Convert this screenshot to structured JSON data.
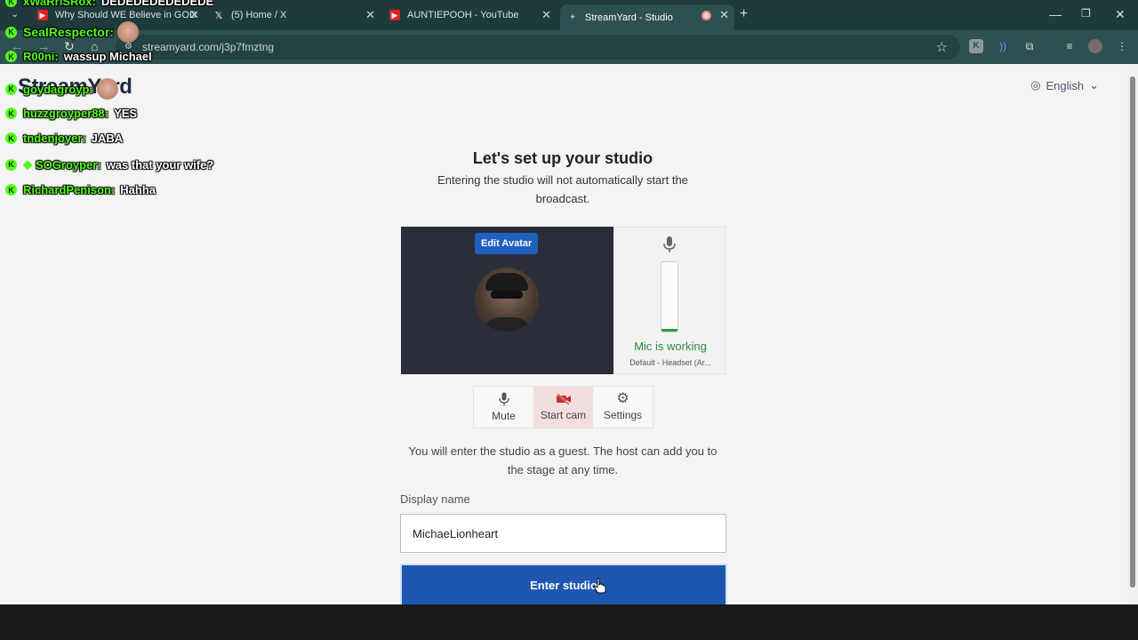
{
  "browser": {
    "tabs": [
      {
        "title": "Why Should WE Believe in GOD",
        "favicon": "youtube-icon"
      },
      {
        "title": "(5) Home / X",
        "favicon": "x-icon"
      },
      {
        "title": "AUNTIEPOOH - YouTube",
        "favicon": "youtube-icon"
      },
      {
        "title": "StreamYard - Studio",
        "favicon": "streamyard-icon",
        "active": true
      }
    ],
    "url": "streamyard.com/j3p7fmztng"
  },
  "page": {
    "logo": "StreamYard",
    "language": "English",
    "heading": "Let's set up your studio",
    "subtext": "Entering the studio will not automatically start the broadcast.",
    "edit_avatar": "Edit Avatar",
    "mic_status": "Mic is working",
    "mic_device": "Default - Headset (Ar...",
    "mic_level": 0.04,
    "controls": {
      "mute": "Mute",
      "start_cam": "Start cam",
      "settings": "Settings"
    },
    "guest_message": "You will enter the studio as a guest. The host can add you to the stage at any time.",
    "display_name_label": "Display name",
    "display_name_value": "MichaeLionheart",
    "enter_button": "Enter studio"
  },
  "chat": [
    {
      "user": "xWaRriSRox:",
      "message": "DEDEDEDEDEDEDE"
    },
    {
      "user": "SealRespector:",
      "message": ""
    },
    {
      "user": "R00ni:",
      "message": "wassup Michael"
    },
    {
      "user": "goydagroyp:",
      "message": ""
    },
    {
      "user": "huzzgroyper88:",
      "message": "YES"
    },
    {
      "user": "tndenjoyer:",
      "message": "JABA"
    },
    {
      "user": "SOGroyper:",
      "message": "was that your wife?"
    },
    {
      "user": "RichardPenison:",
      "message": "Hahha"
    }
  ],
  "colors": {
    "accent": "#1f56b0",
    "mic_ok": "#2e8b3a",
    "chat_name": "#53fc18"
  }
}
